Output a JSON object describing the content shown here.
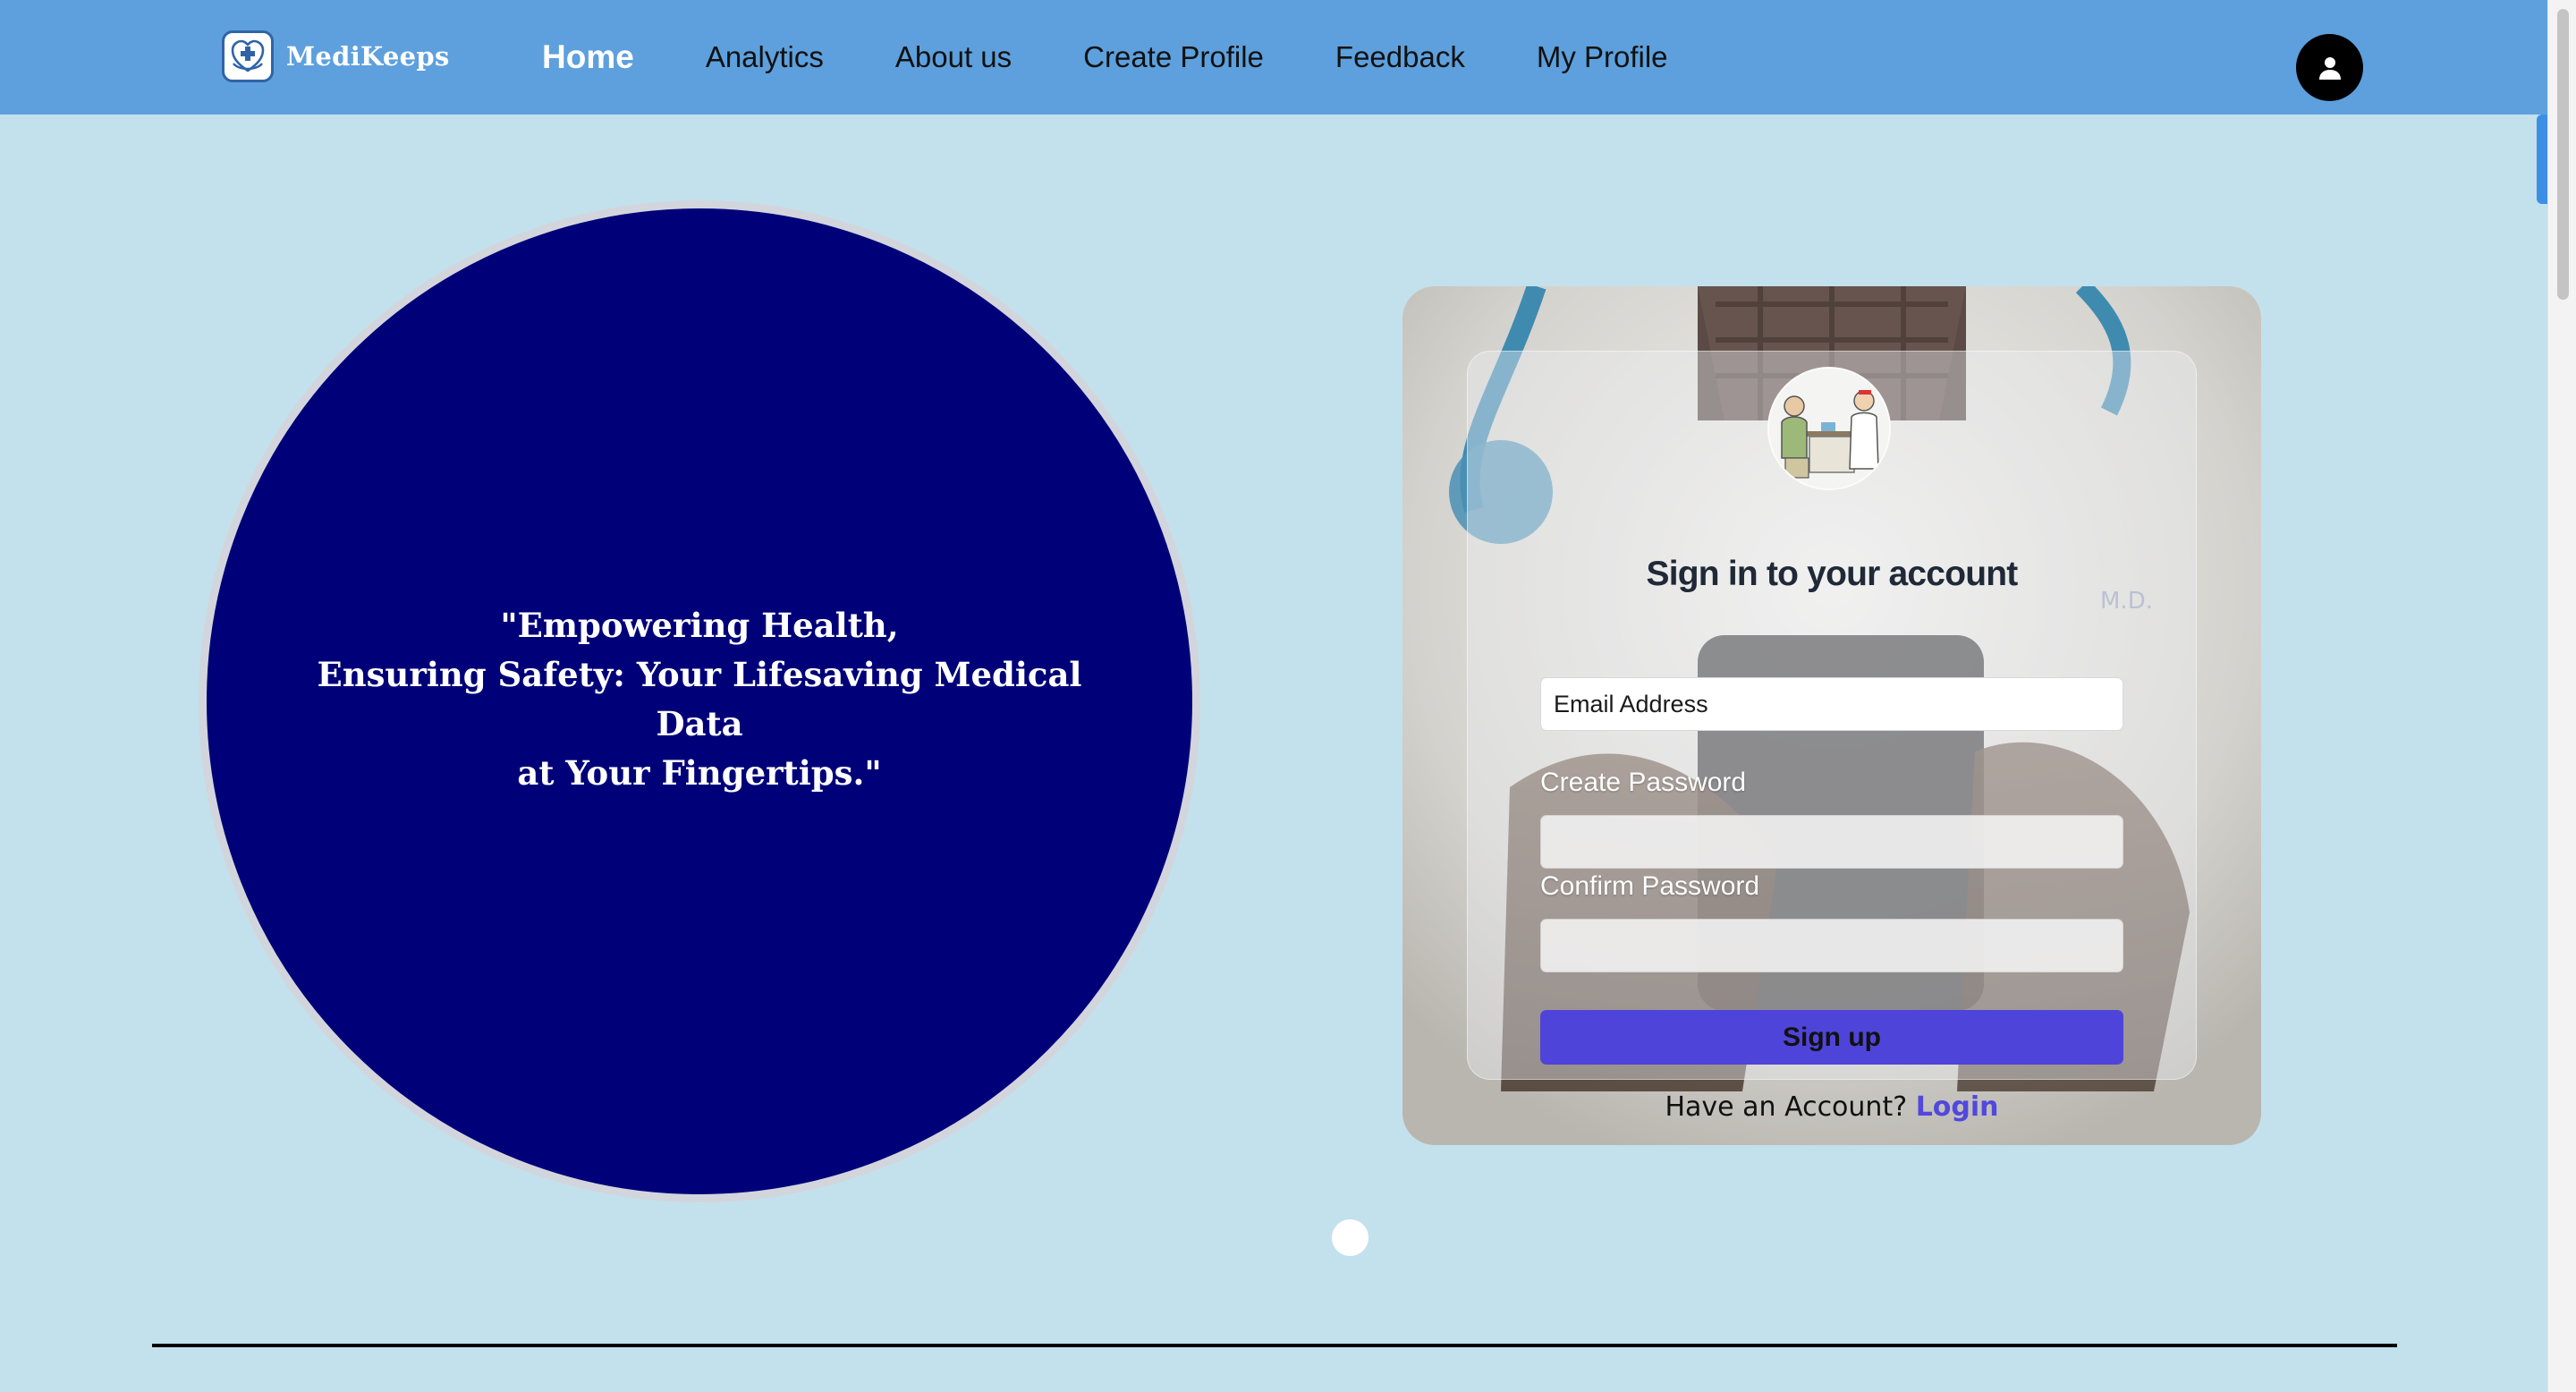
{
  "brand": {
    "name": "MediKeeps",
    "logo_icon": "heart-cross-hands-icon"
  },
  "nav": {
    "links": [
      {
        "label": "Home",
        "active": true
      },
      {
        "label": "Analytics",
        "active": false
      },
      {
        "label": "About us",
        "active": false
      },
      {
        "label": "Create Profile",
        "active": false
      },
      {
        "label": "Feedback",
        "active": false
      },
      {
        "label": "My Profile",
        "active": false
      }
    ],
    "profile_icon": "user-icon"
  },
  "hero": {
    "quote_lines": [
      "\"Empowering Health,",
      "Ensuring Safety: Your Lifesaving Medical Data",
      "at Your Fingertips.\""
    ],
    "circle_color": "#000079"
  },
  "signin": {
    "title": "Sign in to your account",
    "email_placeholder": "Email Address",
    "create_password_label": "Create Password",
    "confirm_password_label": "Confirm Password",
    "signup_button": "Sign up",
    "have_account_text": "Have an Account?",
    "login_link": "Login",
    "accent_color": "#4f44d9"
  },
  "colors": {
    "nav_bg": "#5da0dd",
    "page_bg": "#c3e1ec"
  }
}
